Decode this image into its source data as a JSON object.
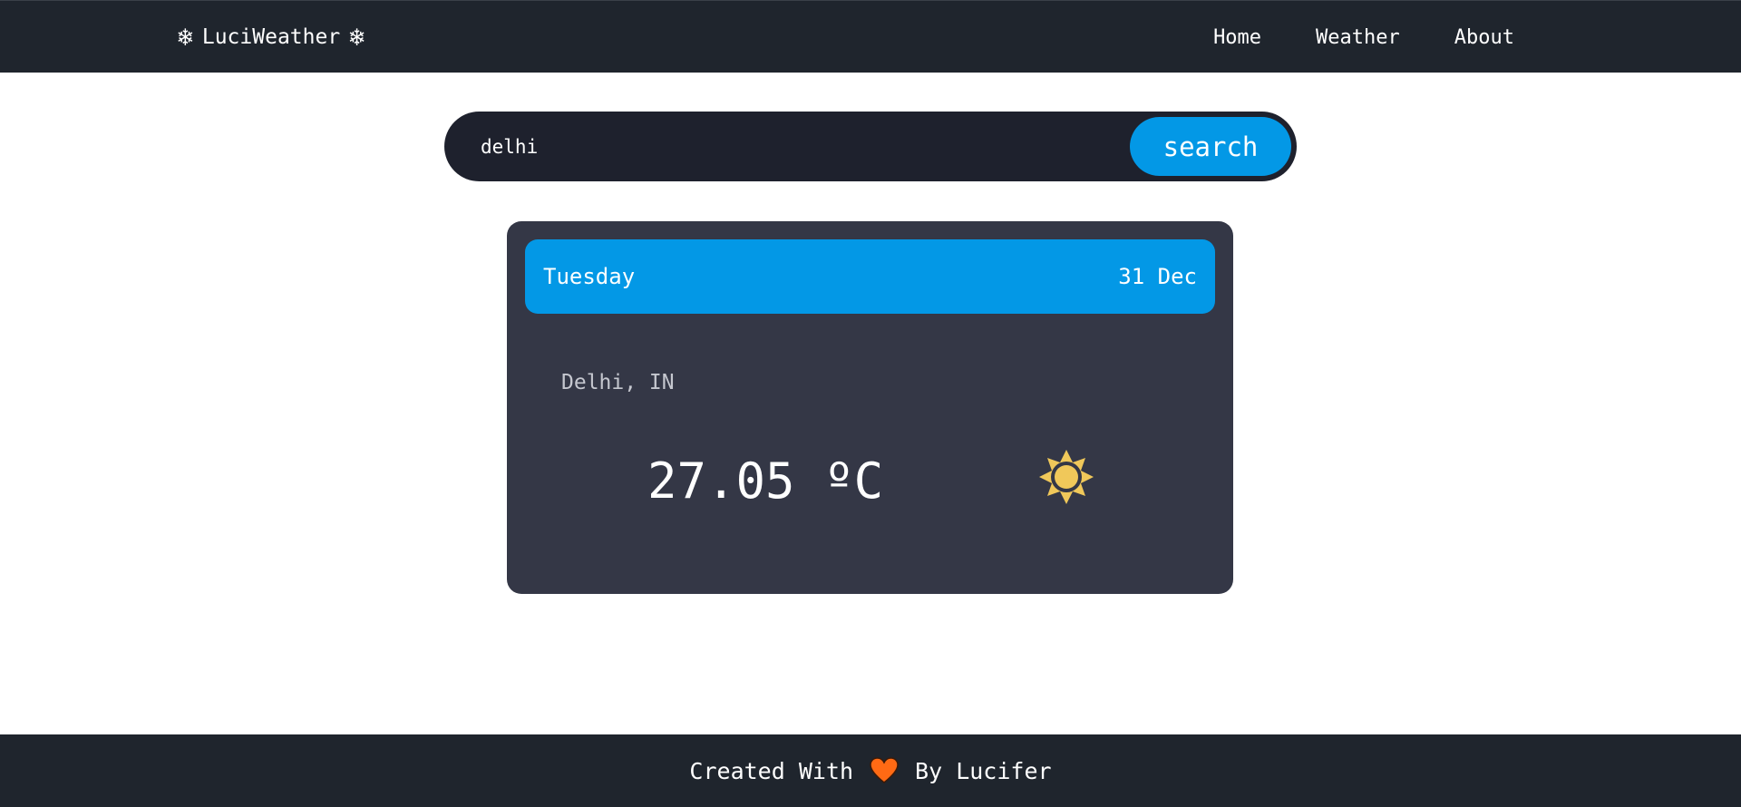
{
  "navbar": {
    "brand": "LuciWeather",
    "brand_icon": "snowflake-icon",
    "snowflake_glyph": "❄",
    "links": [
      {
        "label": "Home"
      },
      {
        "label": "Weather"
      },
      {
        "label": "About"
      }
    ]
  },
  "search": {
    "value": "delhi",
    "button_label": "search"
  },
  "card": {
    "day": "Tuesday",
    "date": "31 Dec",
    "location": "Delhi, IN",
    "temperature": "27.05 ºC",
    "condition_icon": "sun-icon"
  },
  "footer": {
    "prefix": "Created With",
    "suffix": "By Lucifer",
    "icon": "heart-icon"
  },
  "colors": {
    "navbar_bg": "#1f252d",
    "search_bg": "#1e212d",
    "accent": "#0398e6",
    "card_bg": "#343746",
    "sun": "#f0c85a",
    "heart": "#ff6a14"
  }
}
